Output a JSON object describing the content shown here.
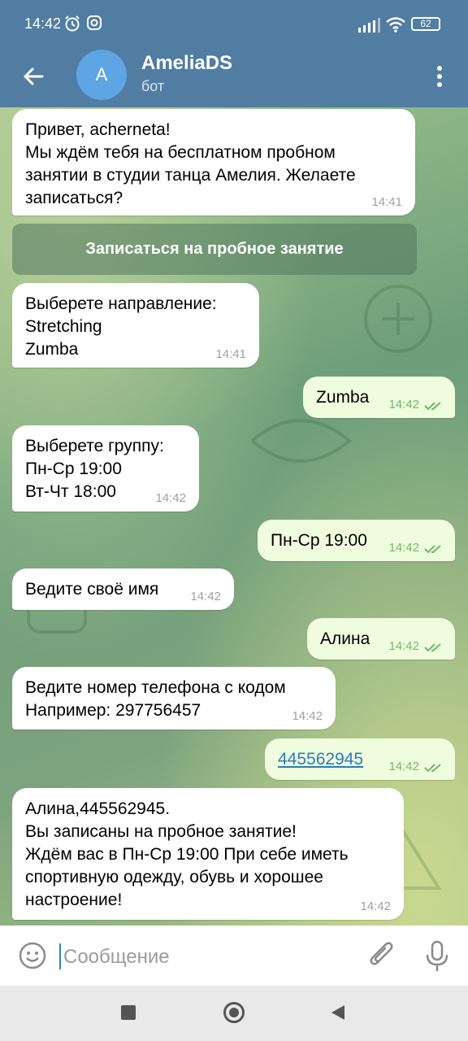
{
  "status": {
    "time": "14:42",
    "battery": "62"
  },
  "header": {
    "avatar_letter": "A",
    "title": "AmeliaDS",
    "subtitle": "бот"
  },
  "keyboard_button": "Записаться на пробное занятие",
  "messages": [
    {
      "dir": "in",
      "text": "Привет, acherneta!\nМы ждём тебя на бесплатном пробном\nзанятии в студии танца Амелия. Желаете\nзаписаться?",
      "time": "14:41"
    },
    {
      "dir": "in",
      "text": "Выберете направление:\nStretching\nZumba",
      "time": "14:41"
    },
    {
      "dir": "out",
      "text": "Zumba",
      "time": "14:42"
    },
    {
      "dir": "in",
      "text": "Выберете группу:\nПн-Ср 19:00\nВт-Чт 18:00",
      "time": "14:42"
    },
    {
      "dir": "out",
      "text": "Пн-Ср 19:00",
      "time": "14:42"
    },
    {
      "dir": "in",
      "text": "Ведите своё имя",
      "time": "14:42"
    },
    {
      "dir": "out",
      "text": "Алина",
      "time": "14:42"
    },
    {
      "dir": "in",
      "text": "Ведите номер телефона с кодом\nНапример: 297756457",
      "time": "14:42"
    },
    {
      "dir": "out",
      "text": "445562945",
      "time": "14:42"
    },
    {
      "dir": "in",
      "text": "Алина,445562945.\nВы записаны на пробное занятие!\nЖдём вас в Пн-Ср 19:00 При себе иметь\nспортивную одежду, обувь и хорошее\nнастроение!",
      "time": "14:42"
    }
  ],
  "input": {
    "placeholder": "Сообщение"
  },
  "colors": {
    "header": "#517da2",
    "incoming": "#ffffff",
    "outgoing": "#effdde",
    "read_ticks": "#6dbb63"
  },
  "icons": [
    "back-arrow-icon",
    "more-vert-icon",
    "emoji-icon",
    "attach-icon",
    "mic-icon",
    "alarm-icon",
    "instagram-icon",
    "signal-icon",
    "wifi-icon",
    "battery-icon"
  ]
}
